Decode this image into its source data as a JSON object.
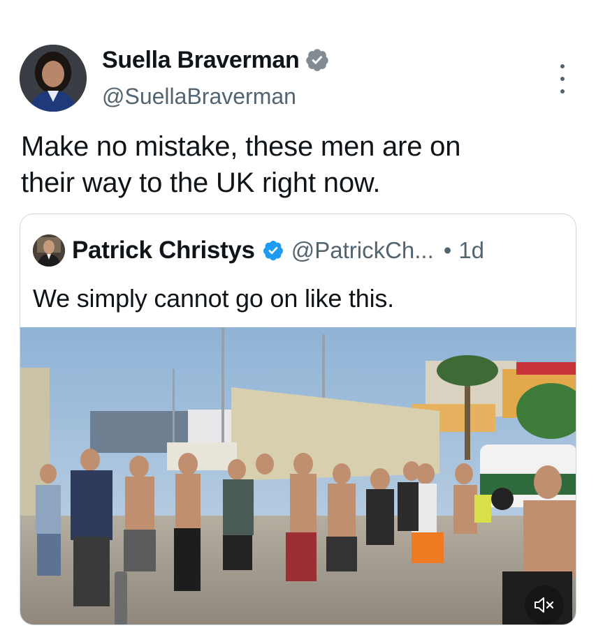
{
  "author": {
    "name": "Suella Braverman",
    "handle": "@SuellaBraverman",
    "avatar_icon": "profile-photo",
    "verified_icon": "verified-badge-icon"
  },
  "tweet": {
    "text_line1": "Make no mistake, these men are on",
    "text_line2": "their way to the UK right now."
  },
  "quoted_tweet": {
    "name": "Patrick Christys",
    "handle": "@PatrickCh...",
    "separator": "•",
    "time": "1d",
    "text": "We simply cannot go on like this.",
    "media": {
      "type": "video",
      "description_icon": "video-thumbnail",
      "mute_icon": "speaker-muted-icon"
    }
  },
  "colors": {
    "verified": "#1d9bf0",
    "text_primary": "#0f1419",
    "text_secondary": "#536471",
    "border": "#cfd9de"
  }
}
